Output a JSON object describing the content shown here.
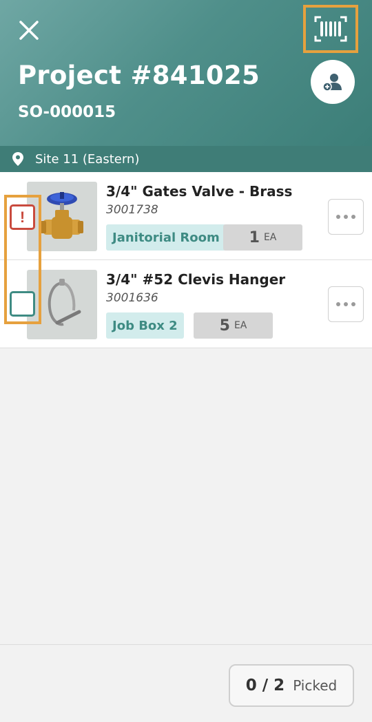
{
  "header": {
    "title": "Project #841025",
    "subtitle": "SO-000015",
    "close_icon": "close-icon",
    "scan_icon": "barcode-scan-icon",
    "assign_icon": "add-user-icon"
  },
  "site": {
    "icon": "location-pin-icon",
    "label": "Site 11 (Eastern)"
  },
  "items": [
    {
      "title": "3/4\" Gates Valve - Brass",
      "sku": "3001738",
      "location": "Janitorial Room",
      "qty": "1",
      "unit": "EA",
      "status": "alert",
      "image": "gate-valve-image"
    },
    {
      "title": "3/4\" #52 Clevis Hanger",
      "sku": "3001636",
      "location": "Job Box 2",
      "qty": "5",
      "unit": "EA",
      "status": "unchecked",
      "image": "clevis-hanger-image"
    }
  ],
  "footer": {
    "picked_count": "0 / 2",
    "picked_label": "Picked"
  },
  "colors": {
    "header_teal": "#4f8f8a",
    "site_bar": "#3f7d77",
    "accent_teal": "#3e8b83",
    "alert_red": "#c94a3d",
    "highlight_orange": "#e6a13e"
  }
}
